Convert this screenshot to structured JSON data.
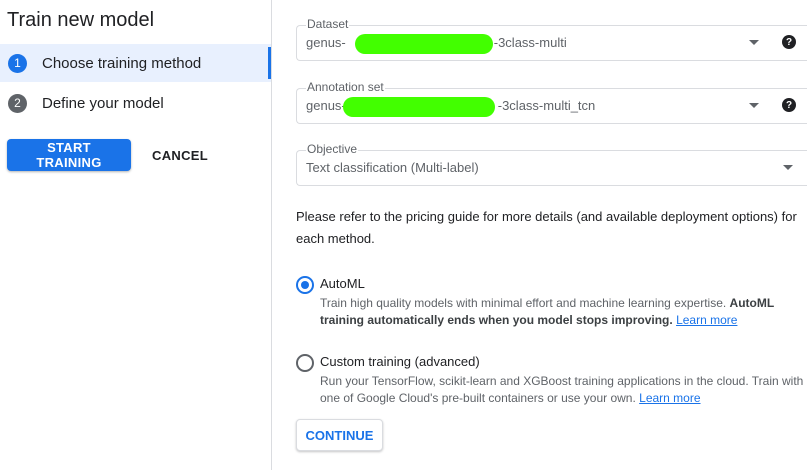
{
  "sidebar": {
    "title": "Train new model",
    "steps": [
      {
        "number": "1",
        "label": "Choose training method",
        "state": "active"
      },
      {
        "number": "2",
        "label": "Define your model",
        "state": "inactive"
      }
    ],
    "start_label": "START TRAINING",
    "cancel_label": "CANCEL"
  },
  "form": {
    "dataset": {
      "label": "Dataset",
      "value_prefix": "genus-",
      "value_suffix": "-3class-multi"
    },
    "annotation_set": {
      "label": "Annotation set",
      "value_prefix": "genus-",
      "value_suffix": "-3class-multi_tcn"
    },
    "objective": {
      "label": "Objective",
      "value": "Text classification (Multi-label)"
    },
    "help_glyph": "?"
  },
  "info_text": "Please refer to the pricing guide for more details (and available deployment options) for each method.",
  "methods": [
    {
      "label": "AutoML",
      "selected": true,
      "desc": "Train high quality models with minimal effort and machine learning expertise. ",
      "desc_bold": "AutoML training automatically ends when you model stops improving.",
      "link": "Learn more"
    },
    {
      "label": "Custom training (advanced)",
      "selected": false,
      "desc": "Run your TensorFlow, scikit-learn and XGBoost training applications in the cloud. Train with one of Google Cloud's pre-built containers or use your own. ",
      "link": "Learn more"
    }
  ],
  "continue_label": "CONTINUE",
  "colors": {
    "accent": "#1a73e8",
    "redaction": "#42ff00",
    "active_step_bg": "#e8f0fe"
  }
}
